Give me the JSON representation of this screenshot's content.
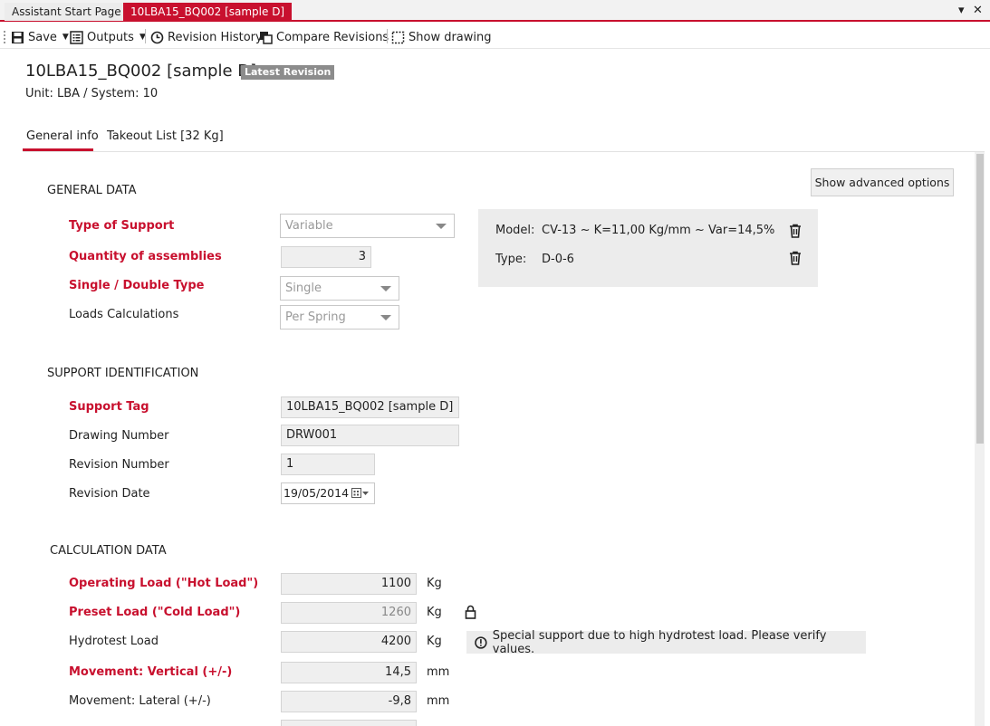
{
  "window_tabs": [
    {
      "label": "Assistant Start Page"
    },
    {
      "label": "10LBA15_BQ002 [sample D]"
    }
  ],
  "toolbar": {
    "save_label": "Save",
    "outputs_label": "Outputs",
    "revision_history_label": "Revision History",
    "compare_revisions_label": "Compare Revisions",
    "show_drawing_label": "Show drawing"
  },
  "header": {
    "title": "10LBA15_BQ002 [sample D]",
    "badge": "Latest Revision",
    "unit_system": "Unit: LBA / System: 10"
  },
  "tabs": [
    {
      "label": "General info"
    },
    {
      "label": "Takeout List [32 Kg]"
    }
  ],
  "advanced_button": "Show advanced options",
  "general_data": {
    "title": "GENERAL DATA",
    "type_of_support": {
      "label": "Type of Support",
      "value": "Variable"
    },
    "quantity": {
      "label": "Quantity of assemblies",
      "value": "3"
    },
    "single_double": {
      "label": "Single / Double Type",
      "value": "Single"
    },
    "loads_calc": {
      "label": "Loads Calculations",
      "value": "Per Spring"
    }
  },
  "model_panel": {
    "model_label": "Model:",
    "model_value": "CV-13 ~ K=11,00 Kg/mm ~ Var=14,5%",
    "type_label": "Type:",
    "type_value": "D-0-6"
  },
  "support_identification": {
    "title": "SUPPORT IDENTIFICATION",
    "support_tag": {
      "label": "Support Tag",
      "value": "10LBA15_BQ002 [sample D]"
    },
    "drawing_number": {
      "label": "Drawing Number",
      "value": "DRW001"
    },
    "revision_number": {
      "label": "Revision Number",
      "value": "1"
    },
    "revision_date": {
      "label": "Revision Date",
      "value": "19/05/2014"
    }
  },
  "calculation_data": {
    "title": "CALCULATION DATA",
    "operating_load": {
      "label": "Operating Load (\"Hot Load\")",
      "value": "1100",
      "unit": "Kg"
    },
    "preset_load": {
      "label": "Preset Load (\"Cold Load\")",
      "value": "1260",
      "unit": "Kg"
    },
    "hydrotest_load": {
      "label": "Hydrotest Load",
      "value": "4200",
      "unit": "Kg"
    },
    "movement_vertical": {
      "label": "Movement: Vertical (+/-)",
      "value": "14,5",
      "unit": "mm"
    },
    "movement_lateral": {
      "label": "Movement: Lateral (+/-)",
      "value": "-9,8",
      "unit": "mm"
    },
    "warning": "Special support due to high hydrotest load. Please verify values."
  },
  "colors": {
    "accent": "#c8102e",
    "panel": "#ececec"
  }
}
